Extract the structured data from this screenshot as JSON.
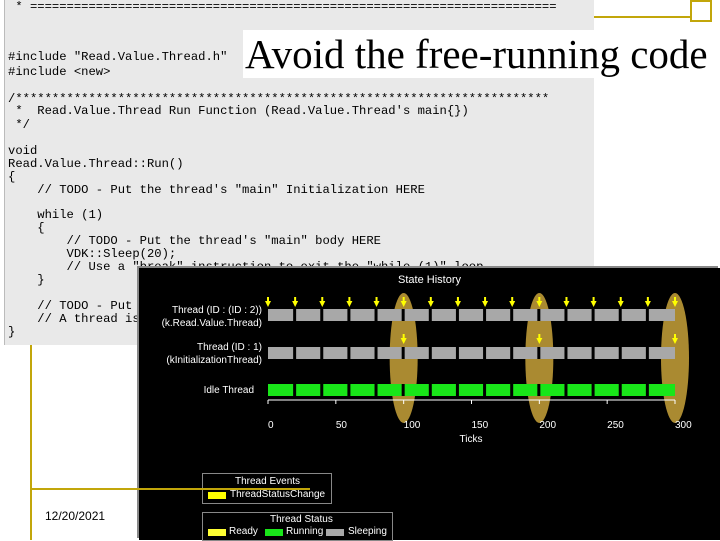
{
  "slide": {
    "title": "Avoid the free-running code",
    "date": "12/20/2021"
  },
  "code": {
    "lines": [
      " * ========================================================================",
      "#include \"Read.Value.Thread.h\"",
      "#include <new>",
      "",
      "/*************************************************************************",
      " *  Read.Value.Thread Run Function (Read.Value.Thread's main{})",
      " */",
      "",
      "void",
      "Read.Value.Thread::Run()",
      "{",
      "    // TODO - Put the thread's \"main\" Initialization HERE",
      "",
      "    while (1)",
      "    {",
      "        // TODO - Put the thread's \"main\" body HERE",
      "        VDK::Sleep(20);",
      "        // Use a \"break\" instruction to exit the \"while (1)\" loop",
      "    }",
      "",
      "    // TODO - Put the thread's exit from \"main\" HERE",
      "    // A thread is automatically Destroyed when it exits its run function",
      "}"
    ]
  },
  "state_history": {
    "title": "State History",
    "threads": [
      {
        "line1": "Thread (ID : (ID : 2))",
        "line2": "(k.Read.Value.Thread)"
      },
      {
        "line1": "Thread (ID : 1)",
        "line2": "(kInitializationThread)"
      },
      {
        "line1": "Idle Thread",
        "line2": ""
      }
    ],
    "ticks": [
      "0",
      "50",
      "100",
      "150",
      "200",
      "250",
      "300"
    ],
    "xlabel": "Ticks",
    "legend_events": {
      "title": "Thread Events",
      "items": [
        "ThreadStatusChange"
      ]
    },
    "legend_status": {
      "title": "Thread Status",
      "items": [
        "Ready",
        "Running",
        "Sleeping"
      ]
    },
    "colors": {
      "running": "#19e619",
      "sleeping": "#a8a8a8",
      "ready": "#ffff33",
      "event": "#ffff00",
      "highlight": "#c8a23a"
    }
  }
}
